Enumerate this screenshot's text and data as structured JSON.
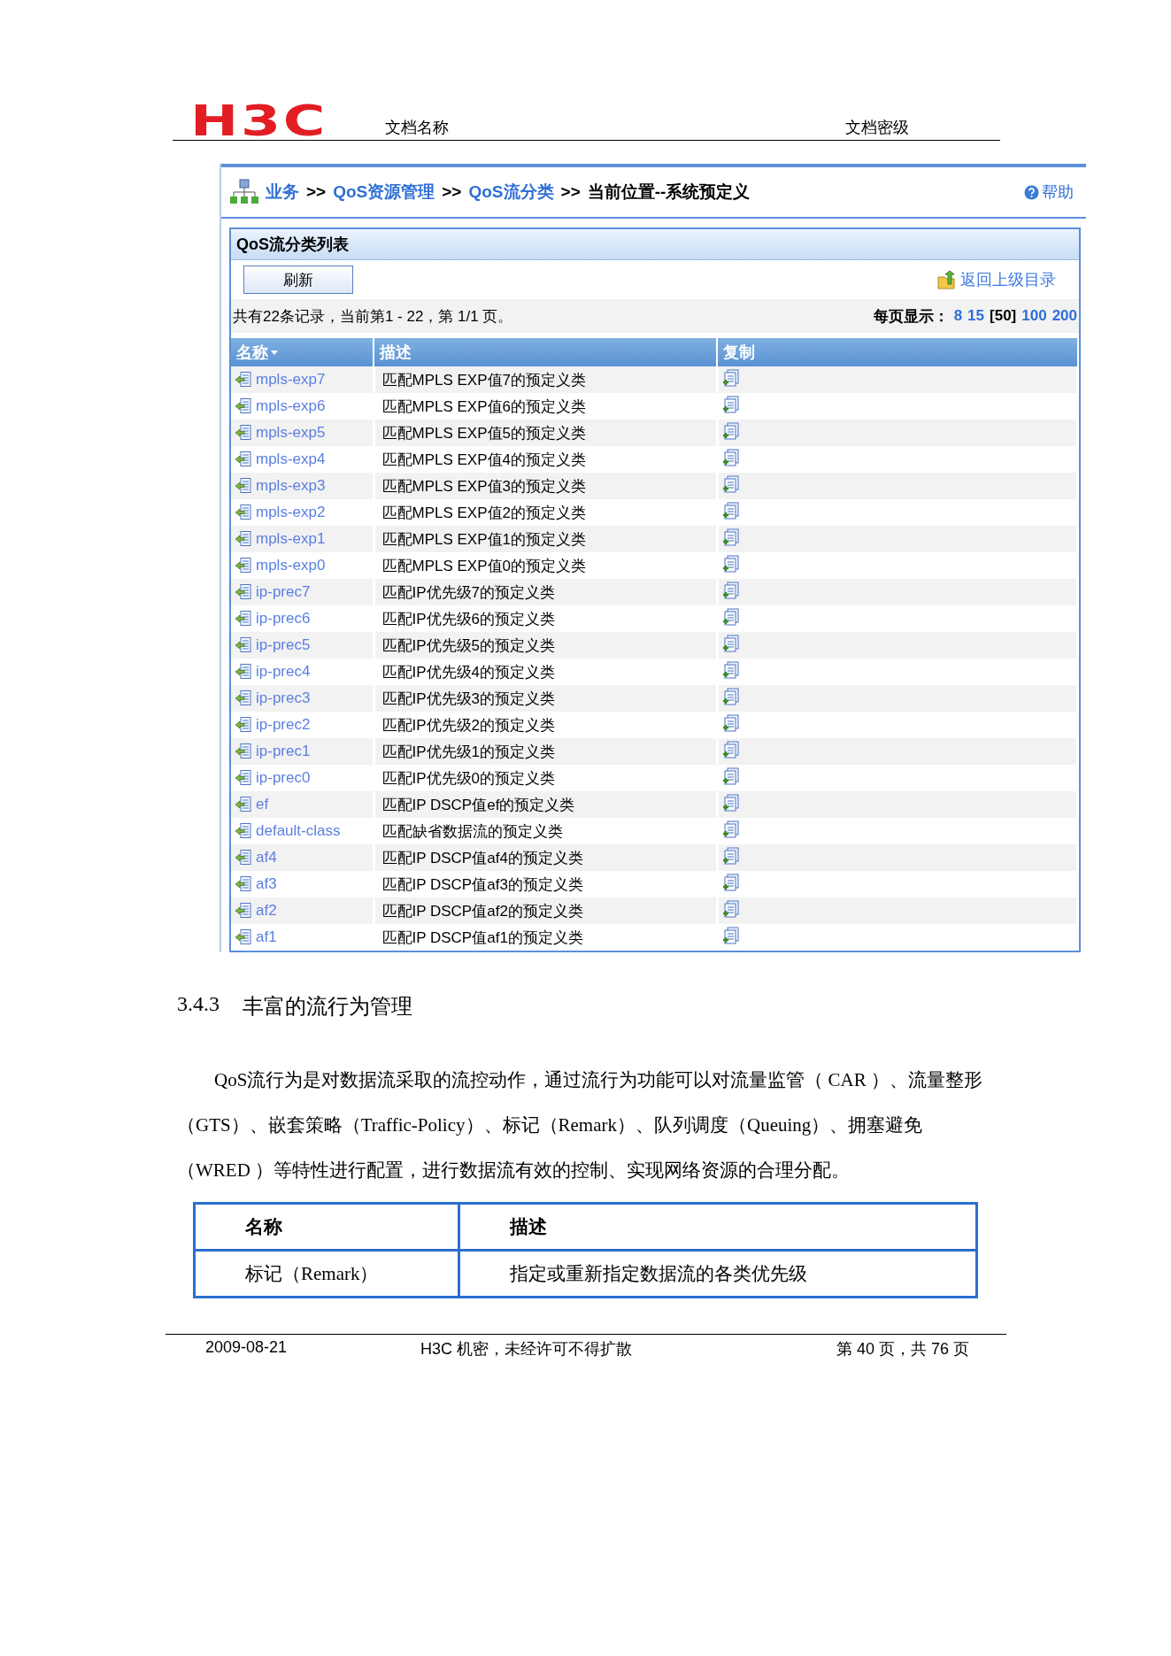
{
  "header": {
    "logo": "H3C",
    "doc_name": "文档名称",
    "doc_level": "文档密级"
  },
  "breadcrumb": [
    {
      "label": "业务",
      "kind": "link"
    },
    {
      "label": ">>",
      "kind": "sep"
    },
    {
      "label": "QoS资源管理",
      "kind": "link"
    },
    {
      "label": ">>",
      "kind": "sep"
    },
    {
      "label": "QoS流分类",
      "kind": "link"
    },
    {
      "label": ">>",
      "kind": "sep"
    },
    {
      "label": "当前位置--系统预定义",
      "kind": "current"
    }
  ],
  "help": "帮助",
  "panel": {
    "title": "QoS流分类列表",
    "refresh_button": "刷新",
    "back_link": "返回上级目录",
    "summary": "共有22条记录，当前第1 - 22，第 1/1 页。",
    "page_size_label": "每页显示：",
    "page_sizes": [
      {
        "label": "8",
        "selected": false
      },
      {
        "label": "15",
        "selected": false
      },
      {
        "label": "[50]",
        "selected": true
      },
      {
        "label": "100",
        "selected": false
      },
      {
        "label": "200",
        "selected": false
      }
    ],
    "columns": [
      "名称",
      "描述",
      "复制"
    ],
    "rows": [
      {
        "name": "mpls-exp7",
        "description": "匹配MPLS EXP值7的预定义类"
      },
      {
        "name": "mpls-exp6",
        "description": "匹配MPLS EXP值6的预定义类"
      },
      {
        "name": "mpls-exp5",
        "description": "匹配MPLS EXP值5的预定义类"
      },
      {
        "name": "mpls-exp4",
        "description": "匹配MPLS EXP值4的预定义类"
      },
      {
        "name": "mpls-exp3",
        "description": "匹配MPLS EXP值3的预定义类"
      },
      {
        "name": "mpls-exp2",
        "description": "匹配MPLS EXP值2的预定义类"
      },
      {
        "name": "mpls-exp1",
        "description": "匹配MPLS EXP值1的预定义类"
      },
      {
        "name": "mpls-exp0",
        "description": "匹配MPLS EXP值0的预定义类"
      },
      {
        "name": "ip-prec7",
        "description": "匹配IP优先级7的预定义类"
      },
      {
        "name": "ip-prec6",
        "description": "匹配IP优先级6的预定义类"
      },
      {
        "name": "ip-prec5",
        "description": "匹配IP优先级5的预定义类"
      },
      {
        "name": "ip-prec4",
        "description": "匹配IP优先级4的预定义类"
      },
      {
        "name": "ip-prec3",
        "description": "匹配IP优先级3的预定义类"
      },
      {
        "name": "ip-prec2",
        "description": "匹配IP优先级2的预定义类"
      },
      {
        "name": "ip-prec1",
        "description": "匹配IP优先级1的预定义类"
      },
      {
        "name": "ip-prec0",
        "description": "匹配IP优先级0的预定义类"
      },
      {
        "name": "ef",
        "description": "匹配IP DSCP值ef的预定义类"
      },
      {
        "name": "default-class",
        "description": "匹配缺省数据流的预定义类"
      },
      {
        "name": "af4",
        "description": "匹配IP DSCP值af4的预定义类"
      },
      {
        "name": "af3",
        "description": "匹配IP DSCP值af3的预定义类"
      },
      {
        "name": "af2",
        "description": "匹配IP DSCP值af2的预定义类"
      },
      {
        "name": "af1",
        "description": "匹配IP DSCP值af1的预定义类"
      }
    ]
  },
  "section": {
    "number": "3.4.3",
    "title": "丰富的流行为管理",
    "paragraph": "QoS流行为是对数据流采取的流控动作，通过流行为功能可以对流量监管（ CAR ）、流量整形（GTS）、嵌套策略（Traffic-Policy）、标记（Remark）、队列调度（Queuing）、拥塞避免（WRED ）等特性进行配置，进行数据流有效的控制、实现网络资源的合理分配。",
    "table": {
      "columns": [
        "名称",
        "描述"
      ],
      "rows": [
        [
          "标记（Remark）",
          "指定或重新指定数据流的各类优先级"
        ]
      ]
    }
  },
  "footer": {
    "date": "2009-08-21",
    "notice": "H3C 机密，未经许可不得扩散",
    "page": "第 40 页，共 76 页"
  }
}
